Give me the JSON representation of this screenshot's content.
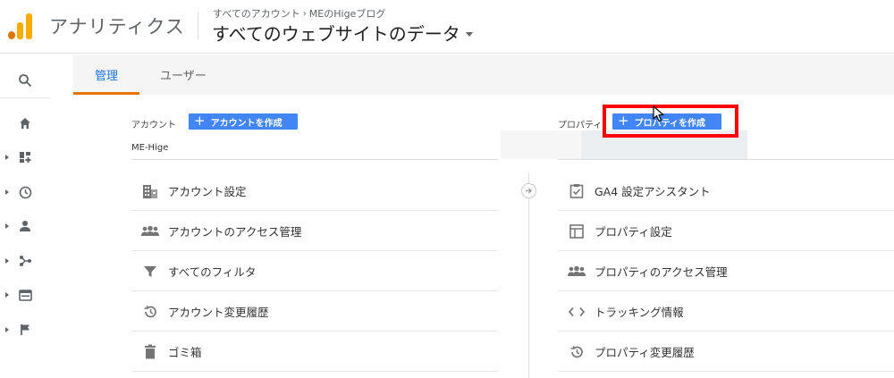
{
  "header": {
    "app_name": "アナリティクス",
    "breadcrumb": [
      "すべてのアカウント",
      "MEのHigeブログ"
    ],
    "view_title": "すべてのウェブサイトのデータ"
  },
  "tabs": [
    {
      "label": "管理",
      "active": true
    },
    {
      "label": "ユーザー",
      "active": false
    }
  ],
  "account": {
    "label": "アカウント",
    "create_button": "アカウントを作成",
    "name": "ME-Hige",
    "items": [
      {
        "label": "アカウント設定",
        "icon": "building-icon"
      },
      {
        "label": "アカウントのアクセス管理",
        "icon": "people-icon"
      },
      {
        "label": "すべてのフィルタ",
        "icon": "filter-icon"
      },
      {
        "label": "アカウント変更履歴",
        "icon": "history-icon"
      },
      {
        "label": "ゴミ箱",
        "icon": "trash-icon"
      }
    ]
  },
  "property": {
    "label": "プロパティ",
    "create_button": "プロパティを作成",
    "items": [
      {
        "label": "GA4 設定アシスタント",
        "icon": "checklist-icon"
      },
      {
        "label": "プロパティ設定",
        "icon": "layout-icon"
      },
      {
        "label": "プロパティのアクセス管理",
        "icon": "people-icon"
      },
      {
        "label": "トラッキング情報",
        "icon": "code-icon"
      },
      {
        "label": "プロパティ変更履歴",
        "icon": "history-icon"
      }
    ]
  },
  "colors": {
    "accent_blue": "#1a73e8",
    "button_blue": "#4285f4",
    "tab_underline": "#e37400",
    "highlight_red": "#ff0000"
  }
}
